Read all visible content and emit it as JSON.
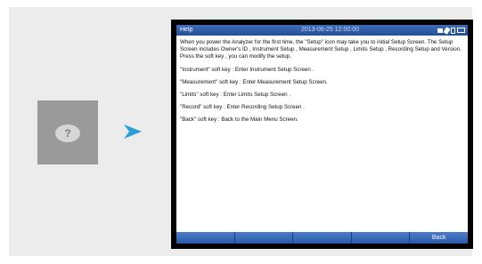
{
  "left_tile": {
    "icon": "help-question-icon",
    "glyph": "?"
  },
  "statusbar": {
    "title": "Help",
    "datetime": "2013-06-25  12:00:00",
    "icons": [
      "usb-icon",
      "wrench-icon",
      "memory-icon",
      "battery-icon"
    ]
  },
  "content": {
    "paragraphs": [
      "When you power the Analyzer for the first time, the \"Setup\" icon may take you to initial Setup Screen. The Setup Screen includes Owner's ID , Instrument Setup , Measurement Setup , Limits Setup , Recording Setup and Version. Press the soft key , you can modify the setup.",
      "\"Instrument\" soft key : Enter Instrument Setup Screen .",
      "\"Measurement\" soft key : Enter Measurement Setup Screen.",
      "\"Limits\" soft key : Enter Limits Setup Screen .",
      "\"Record\" soft key : Enter Recording Setup Screen .",
      "\"Back\" soft key : Back to the Main Menu Screen."
    ]
  },
  "softkeys": [
    "",
    "",
    "",
    "",
    "Back"
  ],
  "colors": {
    "statusbar": "#2f5ca7",
    "softkey": "#3a6bbb",
    "arrow": "#2a9fd6",
    "tile": "#9a9a9a",
    "panel": "#ececec"
  }
}
